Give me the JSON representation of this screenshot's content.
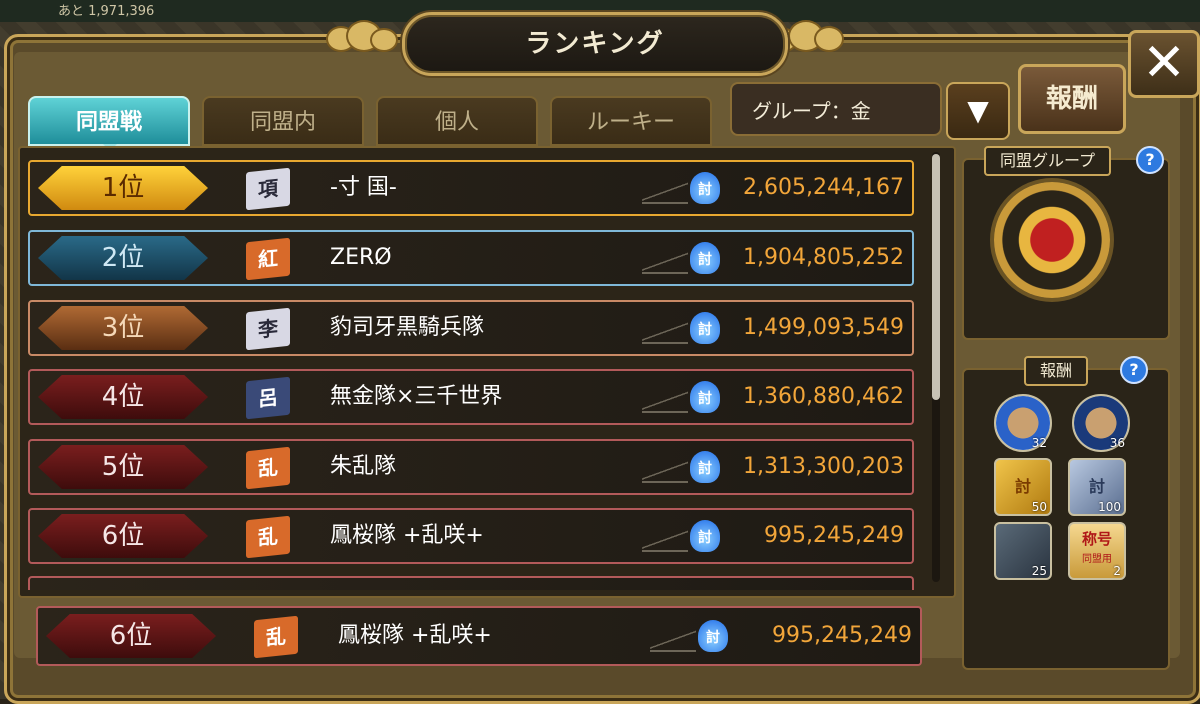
{
  "top_counter": "あと 1,971,396",
  "title": "ランキング",
  "close_label": "✕",
  "tabs": [
    {
      "label": "同盟戦"
    },
    {
      "label": "同盟内"
    },
    {
      "label": "個人"
    },
    {
      "label": "ルーキー"
    }
  ],
  "group_select": {
    "value": "グループ：金",
    "arrow": "▼"
  },
  "reward_button": "報酬",
  "rankings": [
    {
      "rank": "1位",
      "flag": "項",
      "name": "-寸 国-",
      "score": "2,605,244,167"
    },
    {
      "rank": "2位",
      "flag": "紅",
      "name": "ZERØ",
      "score": "1,904,805,252"
    },
    {
      "rank": "3位",
      "flag": "李",
      "name": "豹司牙黒騎兵隊",
      "score": "1,499,093,549"
    },
    {
      "rank": "4位",
      "flag": "呂",
      "name": "無金隊×三千世界",
      "score": "1,360,880,462"
    },
    {
      "rank": "5位",
      "flag": "乱",
      "name": "朱乱隊",
      "score": "1,313,300,203"
    },
    {
      "rank": "6位",
      "flag": "乱",
      "name": "鳳桜隊 +乱咲+",
      "score": "995,245,249"
    }
  ],
  "score_icon": "討",
  "own_ranking": {
    "rank": "6位",
    "flag": "乱",
    "name": "鳳桜隊 +乱咲+",
    "score": "995,245,249"
  },
  "alliance_group": {
    "title": "同盟グループ",
    "help": "?"
  },
  "rewards": {
    "title": "報酬",
    "help": "?",
    "items": [
      {
        "kind": "portrait-medal-gold",
        "count": "32"
      },
      {
        "kind": "portrait-medal-blue",
        "count": "36"
      },
      {
        "kind": "gold-ticket",
        "glyph": "討",
        "count": "50"
      },
      {
        "kind": "silver-ticket",
        "glyph": "討",
        "count": "100"
      },
      {
        "kind": "scroll-item",
        "count": "25"
      },
      {
        "kind": "title-item",
        "glyph": "称号",
        "sub": "同盟用",
        "count": "2"
      }
    ]
  }
}
